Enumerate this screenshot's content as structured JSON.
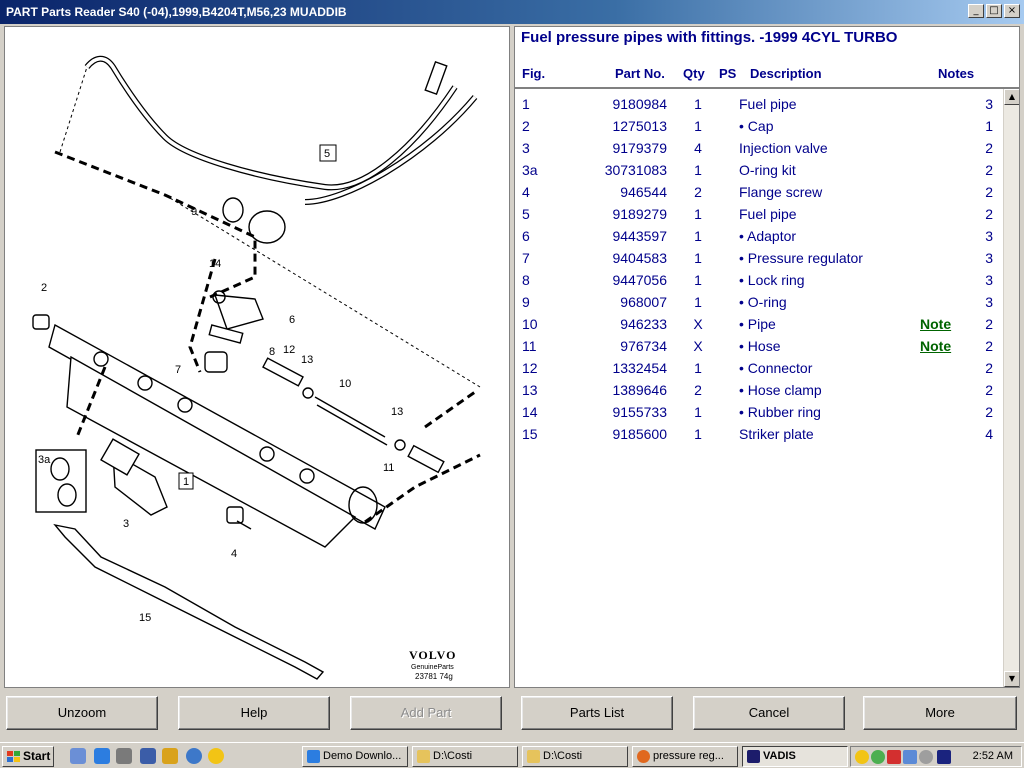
{
  "window": {
    "title": "PART Parts Reader S40 (-04),1999,B4204T,M56,23 MUADDIB",
    "controls": {
      "minimize": "_",
      "maximize": "□",
      "close": "×"
    }
  },
  "diagram": {
    "brand": "VOLVO",
    "sub": "GenuineParts",
    "ref": "23781 74g",
    "callouts": {
      "c1": "1",
      "c2": "2",
      "c3": "3",
      "c3a": "3a",
      "c4": "4",
      "c5": "5",
      "c6": "6",
      "c7": "7",
      "c8": "8",
      "c9": "9",
      "c10": "10",
      "c11": "11",
      "c12": "12",
      "c13a": "13",
      "c13b": "13",
      "c14": "14",
      "c15": "15"
    }
  },
  "parts": {
    "title": "Fuel pressure pipes with fittings. -1999 4CYL TURBO",
    "columns": {
      "fig": "Fig.",
      "part": "Part No.",
      "qty": "Qty",
      "ps": "PS",
      "desc": "Description",
      "notes": "Notes"
    },
    "rows": [
      {
        "fig": "1",
        "part": "9180984",
        "qty": "1",
        "desc": "Fuel pipe",
        "note": "",
        "ps": "3"
      },
      {
        "fig": "2",
        "part": "1275013",
        "qty": "1",
        "desc": "• Cap",
        "note": "",
        "ps": "1"
      },
      {
        "fig": "3",
        "part": "9179379",
        "qty": "4",
        "desc": "Injection valve",
        "note": "",
        "ps": "2"
      },
      {
        "fig": "3a",
        "part": "30731083",
        "qty": "1",
        "desc": "O-ring kit",
        "note": "",
        "ps": "2"
      },
      {
        "fig": "4",
        "part": "946544",
        "qty": "2",
        "desc": "Flange screw",
        "note": "",
        "ps": "2"
      },
      {
        "fig": "5",
        "part": "9189279",
        "qty": "1",
        "desc": "Fuel pipe",
        "note": "",
        "ps": "2"
      },
      {
        "fig": "6",
        "part": "9443597",
        "qty": "1",
        "desc": "• Adaptor",
        "note": "",
        "ps": "3"
      },
      {
        "fig": "7",
        "part": "9404583",
        "qty": "1",
        "desc": "• Pressure regulator",
        "note": "",
        "ps": "3"
      },
      {
        "fig": "8",
        "part": "9447056",
        "qty": "1",
        "desc": "• Lock ring",
        "note": "",
        "ps": "3"
      },
      {
        "fig": "9",
        "part": "968007",
        "qty": "1",
        "desc": "• O-ring",
        "note": "",
        "ps": "3"
      },
      {
        "fig": "10",
        "part": "946233",
        "qty": "X",
        "desc": "• Pipe",
        "note": "Note",
        "ps": "2"
      },
      {
        "fig": "11",
        "part": "976734",
        "qty": "X",
        "desc": "• Hose",
        "note": "Note",
        "ps": "2"
      },
      {
        "fig": "12",
        "part": "1332454",
        "qty": "1",
        "desc": "• Connector",
        "note": "",
        "ps": "2"
      },
      {
        "fig": "13",
        "part": "1389646",
        "qty": "2",
        "desc": "• Hose clamp",
        "note": "",
        "ps": "2"
      },
      {
        "fig": "14",
        "part": "9155733",
        "qty": "1",
        "desc": "• Rubber ring",
        "note": "",
        "ps": "2"
      },
      {
        "fig": "15",
        "part": "9185600",
        "qty": "1",
        "desc": "Striker plate",
        "note": "",
        "ps": "4"
      }
    ]
  },
  "buttons": {
    "unzoom": "Unzoom",
    "help": "Help",
    "add_part": "Add Part",
    "parts_list": "Parts List",
    "cancel": "Cancel",
    "more": "More"
  },
  "taskbar": {
    "start": "Start",
    "tasks": [
      {
        "label": "Demo Downlo...",
        "active": false
      },
      {
        "label": "D:\\Costi",
        "active": false
      },
      {
        "label": "D:\\Costi",
        "active": false
      },
      {
        "label": "pressure reg...",
        "active": false
      },
      {
        "label": "VADIS",
        "active": true
      }
    ],
    "clock": "2:52 AM"
  }
}
